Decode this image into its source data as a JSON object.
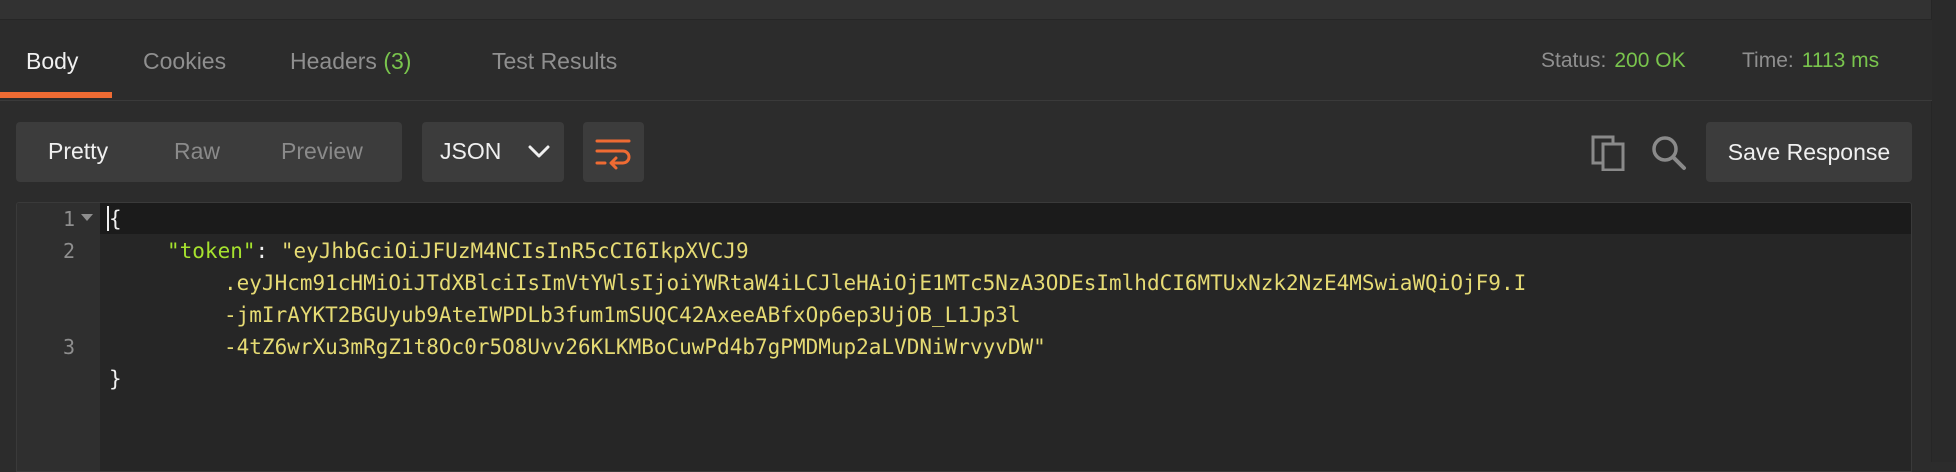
{
  "tabs": [
    {
      "label": "Body"
    },
    {
      "label": "Cookies"
    },
    {
      "label": "Headers",
      "count": "(3)"
    },
    {
      "label": "Test Results"
    }
  ],
  "status": {
    "status_label": "Status:",
    "status_value": "200 OK",
    "time_label": "Time:",
    "time_value": "1113 ms"
  },
  "view_modes": [
    "Pretty",
    "Raw",
    "Preview"
  ],
  "format": {
    "selected": "JSON"
  },
  "toolbar": {
    "save_label": "Save Response"
  },
  "editor": {
    "line_numbers": [
      "1",
      "2",
      "3"
    ],
    "open_brace": "{",
    "close_brace": "}",
    "key": "\"token\"",
    "colon": ": ",
    "token_lines": [
      "\"eyJhbGciOiJFUzM4NCIsInR5cCI6IkpXVCJ9",
      ".eyJHcm91cHMiOiJTdXBlciIsImVtYWlsIjoiYWRtaW4iLCJleHAiOjE1MTc5NzA3ODEsImlhdCI6MTUxNzk2NzE4MSwiaWQiOjF9.I",
      "-jmIrAYKT2BGUyub9AteIWPDLb3fum1mSUQC42AxeeABfxOp6ep3UjOB_L1Jp3l",
      "-4tZ6wrXu3mRgZ1t8Oc0r5O8Uvv26KLKMBoCuwPd4b7gPMDMup2aLVDNiWrvyvDW\""
    ]
  },
  "colors": {
    "accent": "#ef6b33",
    "success": "#79c44d",
    "json_key": "#a6e22e",
    "json_string": "#e6db74"
  },
  "icons": [
    "chevron-down-icon",
    "wrap-lines-icon",
    "copy-icon",
    "search-icon",
    "fold-arrow-icon"
  ]
}
